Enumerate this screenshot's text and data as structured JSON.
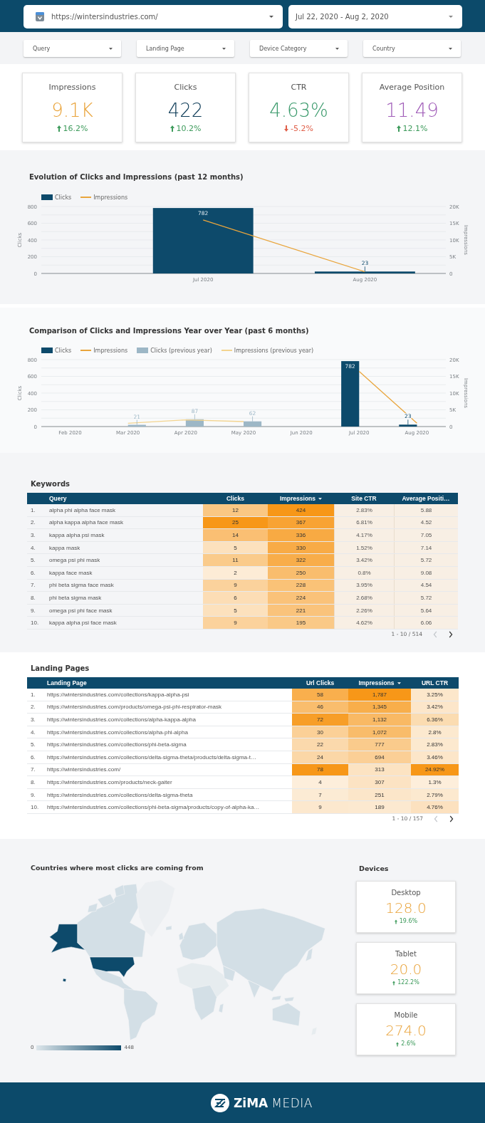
{
  "header": {
    "site_select": {
      "value": "https://wintersindustries.com/"
    },
    "date_select": {
      "value": "Jul 22, 2020 - Aug 2, 2020"
    }
  },
  "filters": [
    {
      "label": "Query"
    },
    {
      "label": "Landing Page"
    },
    {
      "label": "Device Category"
    },
    {
      "label": "Country"
    }
  ],
  "scorecards": [
    {
      "label": "Impressions",
      "value": "9.1K",
      "color": "#e9a33a",
      "change": "16.2%",
      "increase": true
    },
    {
      "label": "Clicks",
      "value": "422",
      "color": "#0d3b57",
      "change": "10.2%",
      "increase": true
    },
    {
      "label": "CTR",
      "value": "4.63%",
      "color": "#3b9a6c",
      "change": "-5.2%",
      "increase": false
    },
    {
      "label": "Average Position",
      "value": "11.49",
      "color": "#a05cb8",
      "change": "12.1%",
      "increase": true
    }
  ],
  "charts": [
    {
      "chart_data": {
        "type": "bar",
        "title": "Evolution of Clicks and Impressions (past 12 months)",
        "legend": "top",
        "grid": true,
        "categories": [
          "Jul 2020",
          "Aug 2020"
        ],
        "ylabel": "Clicks",
        "y2label": "Impressions",
        "ylim": [
          0,
          800
        ],
        "y2lim": [
          0,
          20000
        ],
        "yticks": [
          0,
          200,
          400,
          600,
          800
        ],
        "y2ticks": [
          {
            "value": 0,
            "label": "0"
          },
          {
            "value": 5000,
            "label": "5K"
          },
          {
            "value": 10000,
            "label": "10K"
          },
          {
            "value": 15000,
            "label": "15K"
          },
          {
            "value": 20000,
            "label": "20K"
          }
        ],
        "series": [
          {
            "name": "Clicks",
            "color": "#0d4a6b",
            "values": [
              782,
              23
            ],
            "value_labels": [
              "782",
              "23"
            ]
          },
          {
            "name": "Impressions",
            "type": "line",
            "axis": "y2",
            "color": "#e9a53c",
            "values": [
              16000,
              500
            ]
          }
        ]
      }
    },
    {
      "chart_data": {
        "type": "bar",
        "title": "Comparison of Clicks and Impressions Year over Year (past 6 months)",
        "legend": "top",
        "grid": true,
        "categories": [
          "Feb 2020",
          "Mar 2020",
          "Apr 2020",
          "May 2020",
          "Jun 2020",
          "Jul 2020",
          "Aug 2020"
        ],
        "ylabel": "Clicks",
        "y2label": "Impressions",
        "ylim": [
          0,
          800
        ],
        "y2lim": [
          0,
          20000
        ],
        "yticks": [
          0,
          200,
          400,
          600,
          800
        ],
        "y2ticks": [
          {
            "value": 0,
            "label": "0"
          },
          {
            "value": 5000,
            "label": "5K"
          },
          {
            "value": 10000,
            "label": "10K"
          },
          {
            "value": 15000,
            "label": "15K"
          },
          {
            "value": 20000,
            "label": "20K"
          }
        ],
        "series": [
          {
            "name": "Clicks",
            "color": "#0d4a6b",
            "values": [
              null,
              null,
              null,
              null,
              null,
              782,
              23
            ],
            "value_labels": [
              null,
              null,
              null,
              null,
              null,
              "782",
              "23"
            ]
          },
          {
            "name": "Impressions",
            "type": "line",
            "axis": "y2",
            "color": "#e9a53c",
            "values": [
              null,
              null,
              null,
              null,
              null,
              16500,
              1000
            ]
          },
          {
            "name": "Clicks (previous year)",
            "color": "#9db7c6",
            "values": [
              null,
              21,
              87,
              62,
              null,
              null,
              null
            ],
            "value_labels": [
              null,
              "21",
              "87",
              "62",
              null,
              null,
              null
            ]
          },
          {
            "name": "Impressions (previous year)",
            "type": "line",
            "axis": "y2",
            "color": "#f3d48f",
            "values": [
              null,
              1000,
              2000,
              1500,
              null,
              null,
              null
            ]
          }
        ]
      }
    }
  ],
  "keywords": {
    "title": "Keywords",
    "columns": [
      {
        "label": "Query",
        "kind": "text",
        "sorted": false
      },
      {
        "label": "Clicks",
        "kind": "heatmap",
        "sorted": false
      },
      {
        "label": "Impressions",
        "kind": "heatmap",
        "sorted": true
      },
      {
        "label": "Site CTR",
        "kind": "tinted",
        "sorted": false
      },
      {
        "label": "Average Positi…",
        "kind": "tinted",
        "sorted": false
      }
    ],
    "rows": [
      {
        "index": "1.",
        "cells": [
          "alpha phi alpha face mask",
          "12",
          "424",
          "2.83%",
          "5.88"
        ]
      },
      {
        "index": "2.",
        "cells": [
          "alpha kappa alpha face mask",
          "25",
          "367",
          "6.81%",
          "4.52"
        ]
      },
      {
        "index": "3.",
        "cells": [
          "kappa alpha psi mask",
          "14",
          "336",
          "4.17%",
          "7.05"
        ]
      },
      {
        "index": "4.",
        "cells": [
          "kappa mask",
          "5",
          "330",
          "1.52%",
          "7.14"
        ]
      },
      {
        "index": "5.",
        "cells": [
          "omega psi phi mask",
          "11",
          "322",
          "3.42%",
          "5.72"
        ]
      },
      {
        "index": "6.",
        "cells": [
          "kappa face mask",
          "2",
          "250",
          "0.8%",
          "9.08"
        ]
      },
      {
        "index": "7.",
        "cells": [
          "phi beta sigma face mask",
          "9",
          "228",
          "3.95%",
          "4.54"
        ]
      },
      {
        "index": "8.",
        "cells": [
          "phi beta sigma mask",
          "6",
          "224",
          "2.68%",
          "5.72"
        ]
      },
      {
        "index": "9.",
        "cells": [
          "omega psi phi face mask",
          "5",
          "221",
          "2.26%",
          "5.64"
        ]
      },
      {
        "index": "10.",
        "cells": [
          "kappa alpha psi face mask",
          "9",
          "195",
          "4.62%",
          "6.06"
        ]
      }
    ],
    "pager": {
      "range": "1 - 10 / 514",
      "prev_enabled": false,
      "next_enabled": true
    }
  },
  "landing_pages": {
    "title": "Landing Pages",
    "columns": [
      {
        "label": "Landing Page",
        "kind": "text",
        "sorted": false
      },
      {
        "label": "Url Clicks",
        "kind": "heatmap",
        "sorted": false
      },
      {
        "label": "Impressions",
        "kind": "heatmap",
        "sorted": true
      },
      {
        "label": "URL CTR",
        "kind": "heatmap",
        "sorted": false
      }
    ],
    "rows": [
      {
        "index": "1.",
        "cells": [
          "https://wintersindustries.com/collections/kappa-alpha-psi",
          "58",
          "1,787",
          "3.25%"
        ]
      },
      {
        "index": "2.",
        "cells": [
          "https://wintersindustries.com/products/omega-psi-phi-respirator-mask",
          "46",
          "1,345",
          "3.42%"
        ]
      },
      {
        "index": "3.",
        "cells": [
          "https://wintersindustries.com/collections/alpha-kappa-alpha",
          "72",
          "1,132",
          "6.36%"
        ]
      },
      {
        "index": "4.",
        "cells": [
          "https://wintersindustries.com/collections/alpha-phi-alpha",
          "30",
          "1,072",
          "2.8%"
        ]
      },
      {
        "index": "5.",
        "cells": [
          "https://wintersindustries.com/collections/phi-beta-sigma",
          "22",
          "777",
          "2.83%"
        ]
      },
      {
        "index": "6.",
        "cells": [
          "https://wintersindustries.com/collections/delta-sigma-theta/products/delta-sigma-t…",
          "24",
          "694",
          "3.46%"
        ]
      },
      {
        "index": "7.",
        "cells": [
          "https://wintersindustries.com/",
          "78",
          "313",
          "24.92%"
        ]
      },
      {
        "index": "8.",
        "cells": [
          "https://wintersindustries.com/products/neck-gaiter",
          "4",
          "307",
          "1.3%"
        ]
      },
      {
        "index": "9.",
        "cells": [
          "https://wintersindustries.com/collections/delta-sigma-theta",
          "7",
          "251",
          "2.79%"
        ]
      },
      {
        "index": "10.",
        "cells": [
          "https://wintersindustries.com/collections/phi-beta-sigma/products/copy-of-alpha-ka…",
          "9",
          "189",
          "4.76%"
        ]
      }
    ],
    "pager": {
      "range": "1 - 10 / 157",
      "prev_enabled": false,
      "next_enabled": true
    }
  },
  "map": {
    "title": "Countries where most clicks are coming from",
    "legend": {
      "min": "0",
      "max": "448"
    }
  },
  "devices": {
    "title": "Devices",
    "cards": [
      {
        "label": "Desktop",
        "value": "128.0",
        "change": "19.6%",
        "increase": true
      },
      {
        "label": "Tablet",
        "value": "20.0",
        "change": "122.2%",
        "increase": true
      },
      {
        "label": "Mobile",
        "value": "274.0",
        "change": "2.6%",
        "increase": true
      }
    ]
  },
  "footer": {
    "brand": "ZiMA",
    "brand_suffix": "MEDIA"
  }
}
